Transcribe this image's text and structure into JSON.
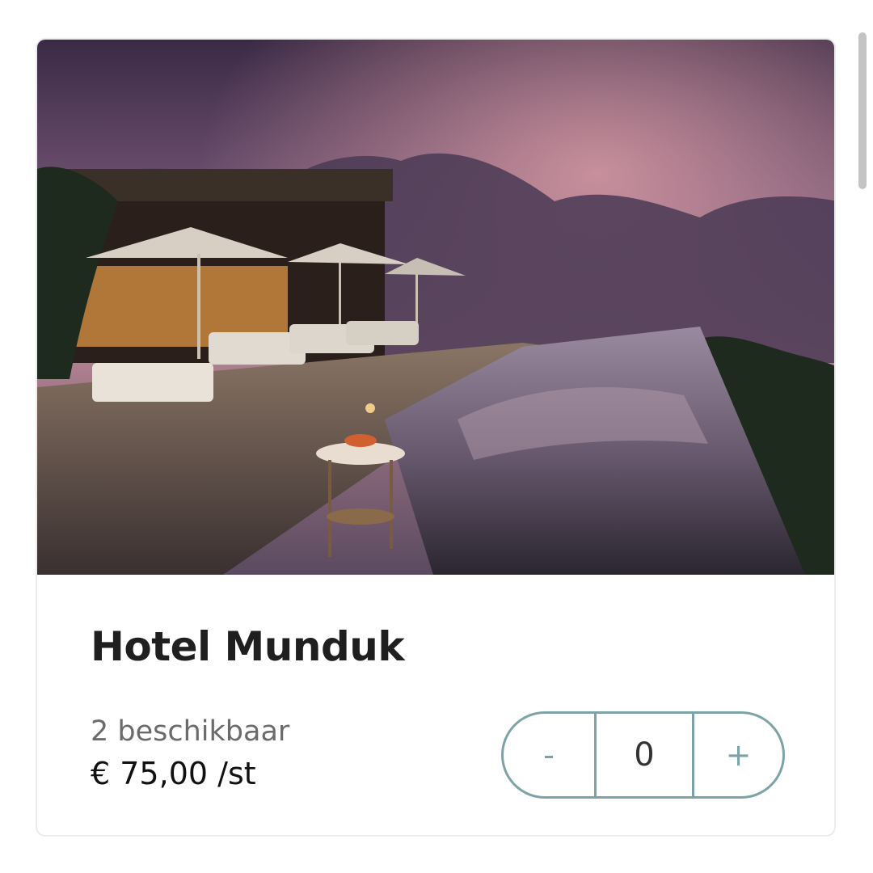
{
  "product": {
    "image_alt": "Hotel Munduk infinity pool at dusk",
    "title": "Hotel Munduk",
    "availability": "2 beschikbaar",
    "price": "€ 75,00",
    "unit": "/st"
  },
  "stepper": {
    "minus_label": "-",
    "quantity": "0",
    "plus_label": "+"
  },
  "colors": {
    "accent": "#7ea3a6",
    "title": "#1f1f1f",
    "muted": "#6b6b6b"
  }
}
